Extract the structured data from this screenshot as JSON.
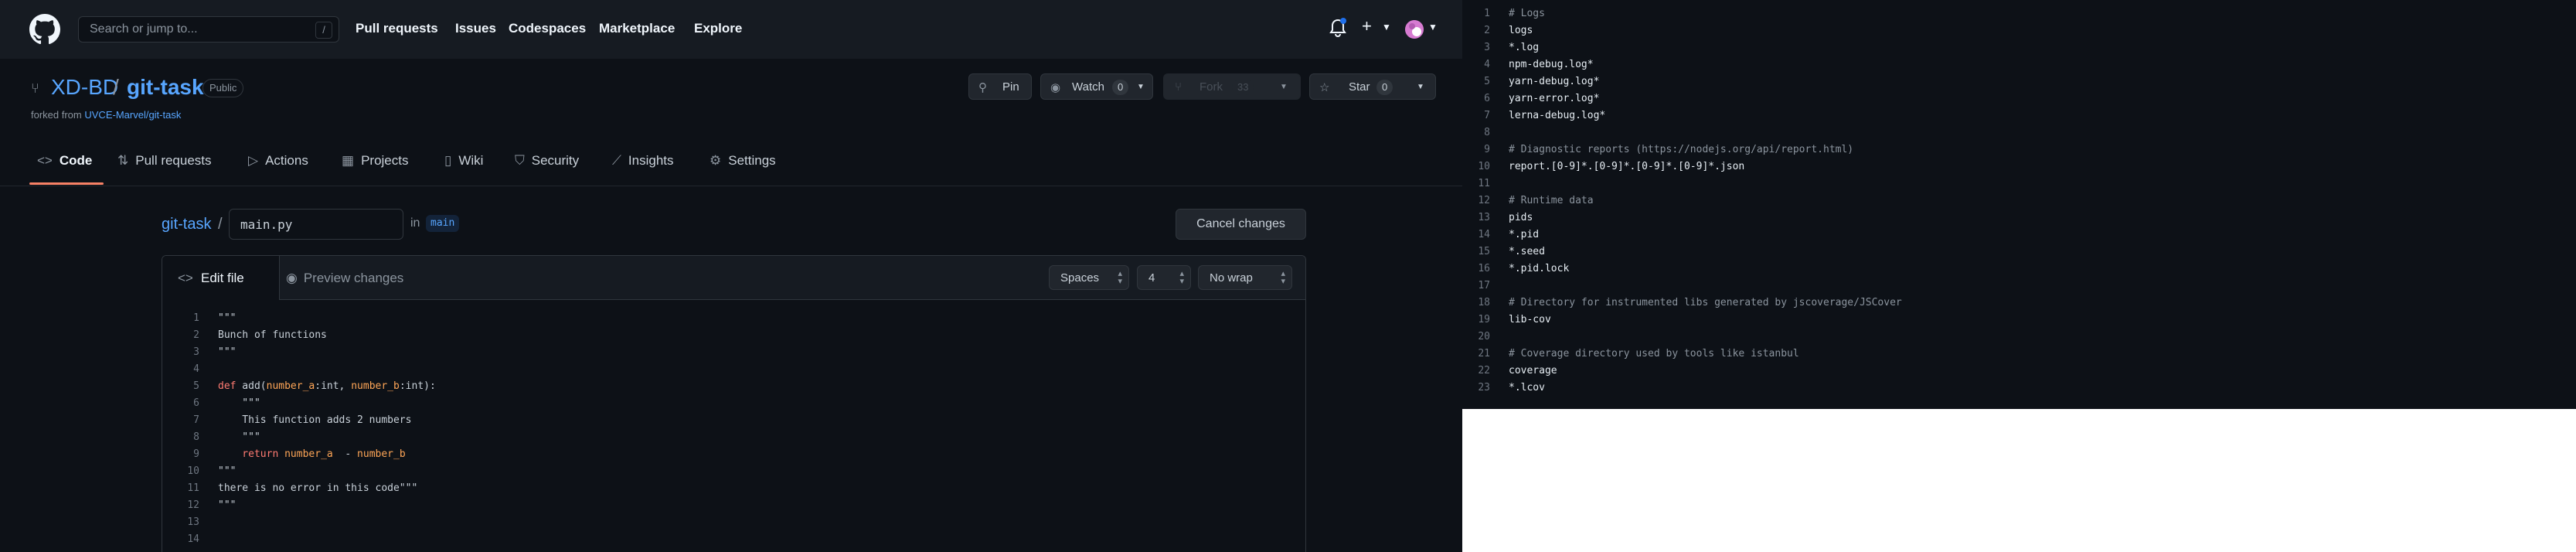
{
  "colors": {
    "bg": "#0d1117",
    "header": "#161b22",
    "link": "#58a6ff",
    "accent": "#f78166",
    "keyword": "#ff7b72",
    "param": "#ffa657",
    "notification": "#1f6feb"
  },
  "header": {
    "search_placeholder": "Search or jump to...",
    "search_shortcut": "/",
    "nav": [
      "Pull requests",
      "Issues",
      "Codespaces",
      "Marketplace",
      "Explore"
    ],
    "icons": [
      "bell-icon",
      "plus-icon",
      "avatar"
    ]
  },
  "repo": {
    "owner": "XD-BD",
    "separator": "/",
    "name": "git-task",
    "visibility": "Public",
    "forked_prefix": "forked from",
    "forked_source": "UVCE-Marvel/git-task",
    "pin_label": "Pin",
    "watch_label": "Watch",
    "watch_count": "0",
    "fork_label": "Fork",
    "fork_count": "33",
    "star_label": "Star",
    "star_count": "0"
  },
  "tabs": [
    {
      "label": "Code",
      "icon": "code-icon"
    },
    {
      "label": "Pull requests",
      "icon": "pr-icon"
    },
    {
      "label": "Actions",
      "icon": "play-icon"
    },
    {
      "label": "Projects",
      "icon": "table-icon"
    },
    {
      "label": "Wiki",
      "icon": "book-icon"
    },
    {
      "label": "Security",
      "icon": "shield-icon"
    },
    {
      "label": "Insights",
      "icon": "graph-icon"
    },
    {
      "label": "Settings",
      "icon": "gear-icon"
    }
  ],
  "editor": {
    "breadcrumb_root": "git-task",
    "breadcrumb_sep": "/",
    "file_name": "main.py",
    "in_text": "in",
    "branch": "main",
    "cancel_label": "Cancel changes",
    "edit_tab": "Edit file",
    "preview_tab": "Preview changes",
    "indent_mode": "Spaces",
    "indent_size": "4",
    "wrap_mode": "No wrap",
    "lines": [
      {
        "n": "1",
        "text": "\"\"\""
      },
      {
        "n": "2",
        "text": "Bunch of functions"
      },
      {
        "n": "3",
        "text": "\"\"\""
      },
      {
        "n": "4",
        "text": ""
      },
      {
        "n": "5",
        "kw": "def",
        "fn": " add(",
        "p1": "number_a",
        "m1": ":int, ",
        "p2": "number_b",
        "m2": ":int):"
      },
      {
        "n": "6",
        "text": "    \"\"\""
      },
      {
        "n": "7",
        "text": "    This function adds 2 numbers"
      },
      {
        "n": "8",
        "text": "    \"\"\""
      },
      {
        "n": "9",
        "kw": "    return",
        "p1": " number_a",
        "m1": "  - ",
        "p2": "number_b",
        "m2": ""
      },
      {
        "n": "10",
        "text": "\"\"\""
      },
      {
        "n": "11",
        "text": "there is no error in this code\"\"\""
      },
      {
        "n": "12",
        "text": "\"\"\""
      },
      {
        "n": "13",
        "text": ""
      },
      {
        "n": "14",
        "text": ""
      }
    ]
  },
  "gitignore": [
    {
      "n": "1",
      "text": "# Logs",
      "comment": true
    },
    {
      "n": "2",
      "text": "logs"
    },
    {
      "n": "3",
      "text": "*.log"
    },
    {
      "n": "4",
      "text": "npm-debug.log*"
    },
    {
      "n": "5",
      "text": "yarn-debug.log*"
    },
    {
      "n": "6",
      "text": "yarn-error.log*"
    },
    {
      "n": "7",
      "text": "lerna-debug.log*"
    },
    {
      "n": "8",
      "text": ""
    },
    {
      "n": "9",
      "text": "# Diagnostic reports (https://nodejs.org/api/report.html)",
      "comment": true
    },
    {
      "n": "10",
      "text": "report.[0-9]*.[0-9]*.[0-9]*.[0-9]*.json"
    },
    {
      "n": "11",
      "text": ""
    },
    {
      "n": "12",
      "text": "# Runtime data",
      "comment": true
    },
    {
      "n": "13",
      "text": "pids"
    },
    {
      "n": "14",
      "text": "*.pid"
    },
    {
      "n": "15",
      "text": "*.seed"
    },
    {
      "n": "16",
      "text": "*.pid.lock"
    },
    {
      "n": "17",
      "text": ""
    },
    {
      "n": "18",
      "text": "# Directory for instrumented libs generated by jscoverage/JSCover",
      "comment": true
    },
    {
      "n": "19",
      "text": "lib-cov"
    },
    {
      "n": "20",
      "text": ""
    },
    {
      "n": "21",
      "text": "# Coverage directory used by tools like istanbul",
      "comment": true
    },
    {
      "n": "22",
      "text": "coverage"
    },
    {
      "n": "23",
      "text": "*.lcov"
    }
  ]
}
